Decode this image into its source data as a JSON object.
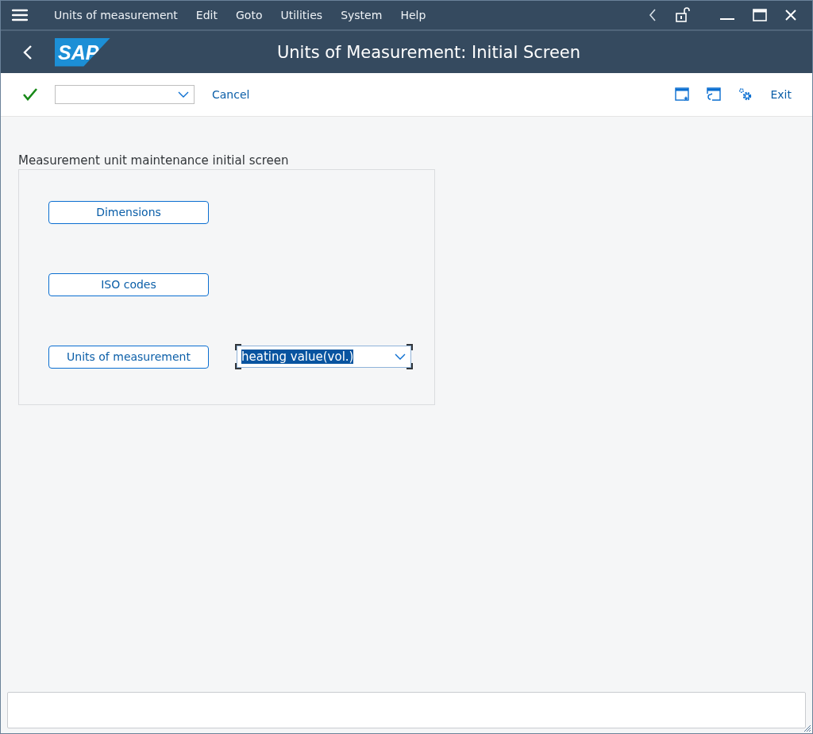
{
  "menu_bar": {
    "items": [
      {
        "label": "Units of measurement"
      },
      {
        "label": "Edit"
      },
      {
        "label": "Goto"
      },
      {
        "label": "Utilities"
      },
      {
        "label": "System"
      },
      {
        "label": "Help"
      }
    ]
  },
  "title_bar": {
    "logo": "SAP",
    "title": "Units of Measurement: Initial Screen"
  },
  "toolbar": {
    "cancel": "Cancel",
    "exit": "Exit"
  },
  "group": {
    "title": "Measurement unit maintenance initial screen",
    "rows": [
      {
        "button": "Dimensions"
      },
      {
        "button": "ISO codes"
      },
      {
        "button": "Units of measurement",
        "dropdown": {
          "value": "heating value(vol.)",
          "focused": true
        }
      }
    ]
  }
}
